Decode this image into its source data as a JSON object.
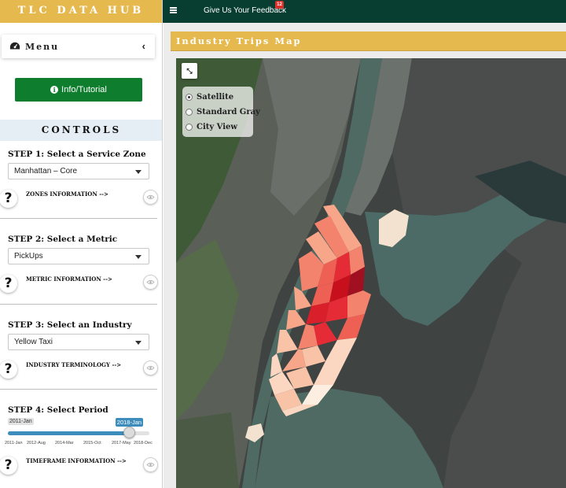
{
  "brand": {
    "title": "TLC DATA HUB"
  },
  "topbar": {
    "feedback_label": "Give Us Your Feedback",
    "badge_count": "12"
  },
  "sidebar": {
    "menu_label": "Menu",
    "info_button": "Info/Tutorial",
    "controls_title": "CONTROLS",
    "steps": [
      {
        "title": "STEP 1: Select a Service Zone",
        "selected": "Manhattan – Core",
        "info_label": "ZONES INFORMATION -->"
      },
      {
        "title": "STEP 2: Select a Metric",
        "selected": "PickUps",
        "info_label": "METRIC INFORMATION -->"
      },
      {
        "title": "STEP 3: Select an Industry",
        "selected": "Yellow Taxi",
        "info_label": "INDUSTRY TERMINOLOGY -->"
      },
      {
        "title": "STEP 4: Select Period",
        "info_label": "TIMEFRAME INFORMATION -->"
      }
    ],
    "period_slider": {
      "min_label": "2011-Jan",
      "value_label": "2018-Jan",
      "value_fraction": 0.86,
      "ticks": [
        "2011-Jan",
        "2012-Aug",
        "2014-Mar",
        "2015-Oct",
        "2017-May",
        "2018-Dec"
      ]
    }
  },
  "main": {
    "panel_title": "Industry Trips Map",
    "layers": [
      {
        "label": "Satellite",
        "checked": true
      },
      {
        "label": "Standard Gray",
        "checked": false
      },
      {
        "label": "City View",
        "checked": false
      }
    ],
    "colors": {
      "brand": "#e6b94f",
      "topbar": "#083d31",
      "info_button": "#0e7e2e",
      "slider": "#3c8dbc"
    }
  }
}
